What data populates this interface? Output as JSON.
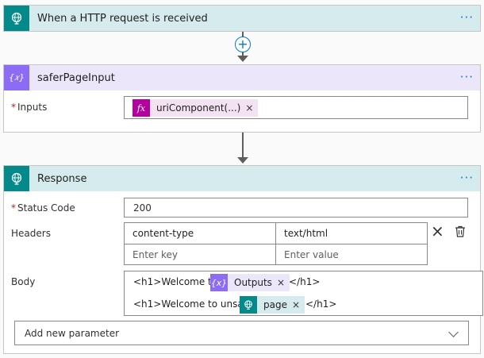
{
  "trigger": {
    "title": "When a HTTP request is received",
    "menu": "···"
  },
  "add_step": "+",
  "compose": {
    "title": "safer​PageInput",
    "menu": "···",
    "inputs_label": "Inputs",
    "required_mark": "*",
    "token": {
      "icon": "fx",
      "label": "uriComponent(...)",
      "remove": "×"
    }
  },
  "response": {
    "title": "Response",
    "menu": "···",
    "status_label": "Status Code",
    "status_value": "200",
    "headers_label": "Headers",
    "headers": {
      "key": "content-type",
      "value": "text/html",
      "key_placeholder": "Enter key",
      "value_placeholder": "Enter value"
    },
    "header_remove": "×",
    "body_label": "Body",
    "body": {
      "line1_prefix": "<h1>Welcome to",
      "line1_token": "Outputs",
      "line1_token_icon": "{x}",
      "line1_suffix": "</h1>",
      "line2_prefix": "<h1>Welcome to unsafe",
      "line2_token": "page",
      "line2_suffix": "</h1>",
      "token_remove": "×"
    },
    "add_param": "Add new parameter"
  },
  "colors": {
    "teal": "#048a8a",
    "teal_bg": "#d6ebee",
    "purple": "#8c6cf7",
    "purple_bg": "#ece6fb",
    "fx": "#b4009e",
    "token_bg_purple": "#ece6fb",
    "token_bg_teal": "#d6ebee",
    "link": "#0078d4"
  }
}
